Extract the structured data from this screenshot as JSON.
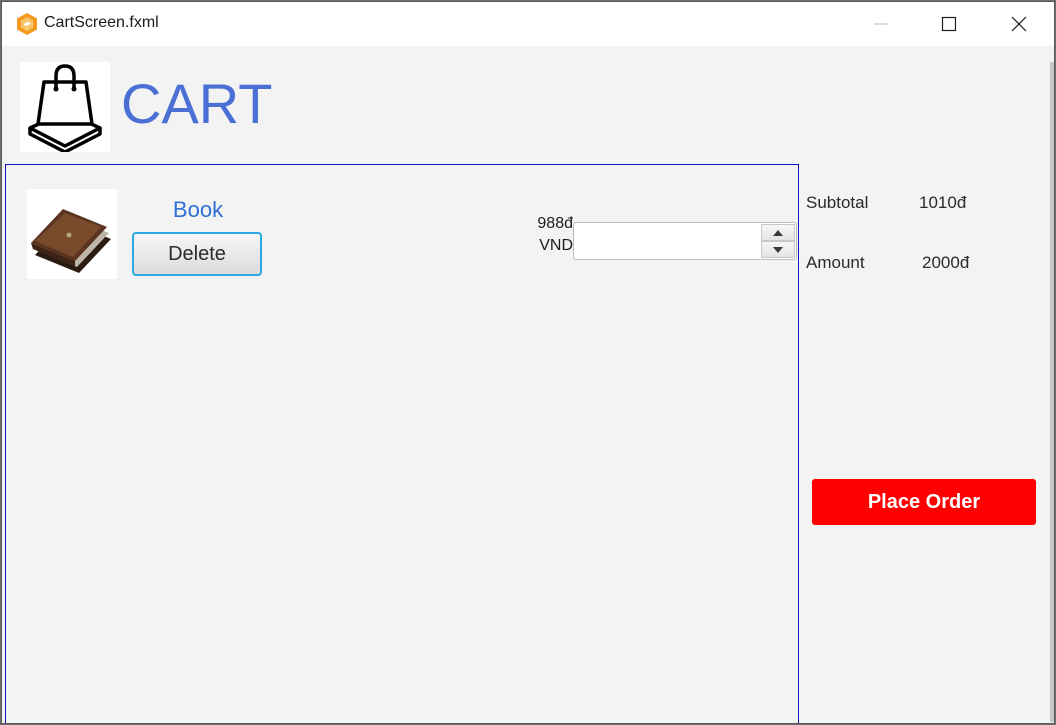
{
  "window": {
    "title": "CartScreen.fxml",
    "controls": {
      "minimize_icon": "minimize-icon",
      "maximize_icon": "maximize-icon",
      "close_icon": "close-icon"
    }
  },
  "header": {
    "logo_icon": "shopping-bag-icon",
    "title": "CART"
  },
  "cart": {
    "items": [
      {
        "image_icon": "book-icon",
        "name": "Book",
        "delete_label": "Delete",
        "price": "988đ",
        "currency": "VND",
        "quantity": ""
      }
    ]
  },
  "summary": {
    "subtotal_label": "Subtotal",
    "subtotal_value": "1010đ",
    "amount_label": "Amount",
    "amount_value": "2000đ",
    "place_order_label": "Place Order"
  },
  "colors": {
    "accent_title": "#4a70d6",
    "panel_border": "#1212c8",
    "place_order_bg": "#ff0000"
  }
}
